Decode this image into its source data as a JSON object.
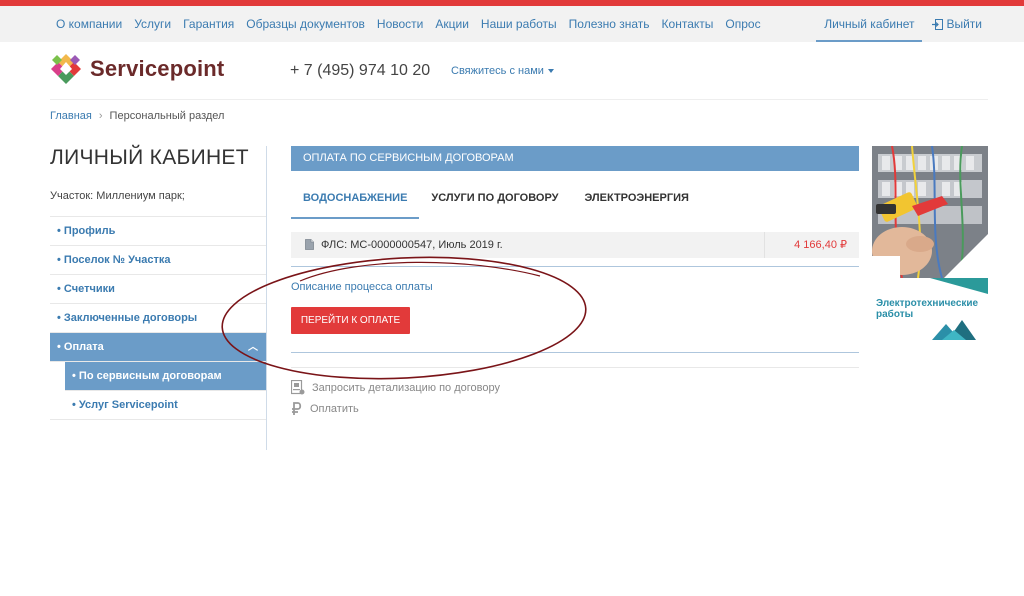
{
  "topnav": {
    "items": [
      "О компании",
      "Услуги",
      "Гарантия",
      "Образцы документов",
      "Новости",
      "Акции",
      "Наши работы",
      "Полезно знать",
      "Контакты",
      "Опрос"
    ],
    "cabinet": "Личный кабинет",
    "logout": "Выйти"
  },
  "header": {
    "brand": "Servicepoint",
    "phone": "+ 7 (495) 974 10 20",
    "contact": "Свяжитесь с нами"
  },
  "breadcrumb": {
    "home": "Главная",
    "current": "Персональный раздел"
  },
  "sidebar": {
    "title": "ЛИЧНЫЙ КАБИНЕТ",
    "plot_label": "Участок: Миллениум парк;",
    "items": [
      "• Профиль",
      "• Поселок № Участка",
      "• Счетчики",
      "• Заключенные договоры",
      "• Оплата"
    ],
    "sub_items": [
      "• По сервисным договорам",
      "• Услуг Servicepoint"
    ]
  },
  "main": {
    "section_title": "ОПЛАТА ПО СЕРВИСНЫМ ДОГОВОРАМ",
    "tabs": [
      "ВОДОСНАБЖЕНИЕ",
      "УСЛУГИ ПО ДОГОВОРУ",
      "ЭЛЕКТРОЭНЕРГИЯ"
    ],
    "invoice": {
      "name": "ФЛС: МС-0000000547, Июль 2019 г.",
      "amount": "4 166,40 ₽"
    },
    "description_link": "Описание процесса оплаты",
    "pay_button": "ПЕРЕЙТИ К ОПЛАТЕ",
    "actions": [
      "Запросить детализацию по договору",
      "Оплатить"
    ]
  },
  "ad": {
    "line1": "Электротехнические",
    "line2": "работы"
  },
  "colors": {
    "accent_blue": "#6b9cc8",
    "link_blue": "#3b7bb0",
    "accent_red": "#e23a3a",
    "brand": "#6b2a2a",
    "annotation": "#7a1418"
  }
}
